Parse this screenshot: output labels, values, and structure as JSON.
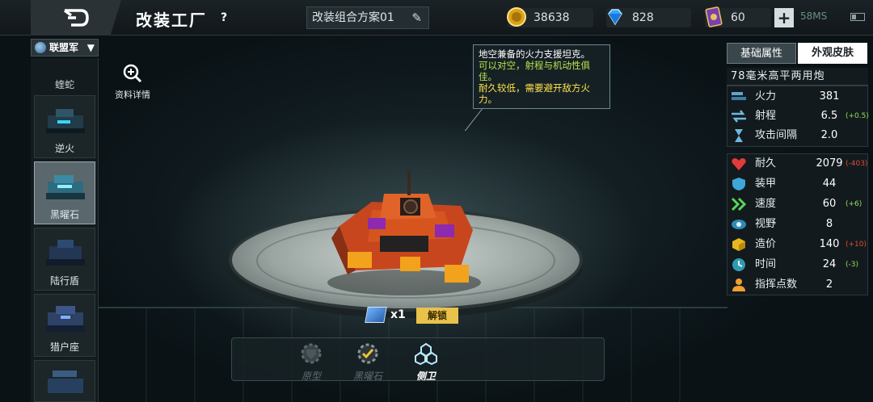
{
  "header": {
    "title": "改装工厂",
    "help": "?",
    "plan_name": "改装组合方案01",
    "gold": "38638",
    "diamond": "828",
    "cards": "60",
    "plus": "+",
    "network": "58MS"
  },
  "sidebar": {
    "faction": "联盟军",
    "top_label": "蝰蛇",
    "items": [
      {
        "label": "逆火"
      },
      {
        "label": "黑曜石"
      },
      {
        "label": "陆行盾"
      },
      {
        "label": "猎户座"
      }
    ]
  },
  "detail_label": "资料详情",
  "tooltip": {
    "line1": "地空兼备的火力支援坦克。",
    "line2": "可以对空，射程与机动性俱佳。",
    "line3": "耐久较低，需要避开敌方火力。"
  },
  "panel": {
    "tab_base": "基础属性",
    "tab_skin": "外观皮肤",
    "weapon": "78毫米高平两用炮",
    "combat": [
      {
        "name": "火力",
        "value": "381",
        "bonus": ""
      },
      {
        "name": "射程",
        "value": "6.5",
        "bonus": "(+0.5)"
      },
      {
        "name": "攻击间隔",
        "value": "2.0",
        "bonus": ""
      }
    ],
    "stats": [
      {
        "name": "耐久",
        "value": "2079",
        "bonus": "(-403)"
      },
      {
        "name": "装甲",
        "value": "44",
        "bonus": ""
      },
      {
        "name": "速度",
        "value": "60",
        "bonus": "(+6)"
      },
      {
        "name": "视野",
        "value": "8",
        "bonus": ""
      },
      {
        "name": "造价",
        "value": "140",
        "bonus": "(+10)"
      },
      {
        "name": "时间",
        "value": "24",
        "bonus": "(-3)"
      },
      {
        "name": "指挥点数",
        "value": "2",
        "bonus": ""
      }
    ]
  },
  "unlock": {
    "qty": "x1",
    "button": "解锁"
  },
  "mods": [
    {
      "label": "原型"
    },
    {
      "label": "黑曜石"
    },
    {
      "label": "侧卫"
    }
  ]
}
